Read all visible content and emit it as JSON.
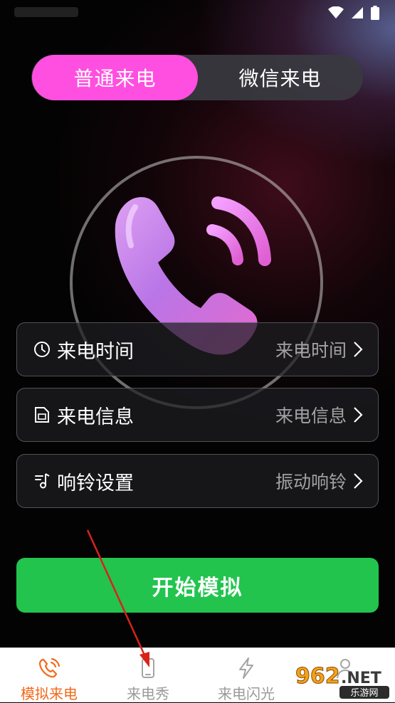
{
  "tabs": {
    "normal_call": "普通来电",
    "wechat_call": "微信来电"
  },
  "settings": [
    {
      "label": "来电时间",
      "value": "来电时间",
      "icon": "clock-icon"
    },
    {
      "label": "来电信息",
      "value": "来电信息",
      "icon": "sim-card-icon"
    },
    {
      "label": "响铃设置",
      "value": "振动响铃",
      "icon": "music-note-icon"
    }
  ],
  "start_button": "开始模拟",
  "bottom_nav": [
    {
      "label": "模拟来电",
      "icon": "phone-ringing-icon",
      "active": true
    },
    {
      "label": "来电秀",
      "icon": "smartphone-icon",
      "active": false
    },
    {
      "label": "来电闪光",
      "icon": "lightning-icon",
      "active": false
    },
    {
      "label": "",
      "icon": "person-icon",
      "active": false
    }
  ],
  "watermark": {
    "text": "962.NET",
    "subtext": "乐游网"
  },
  "colors": {
    "accent_pink": "#ff4fe0",
    "start_green": "#22c44e",
    "nav_active": "#f26a1b",
    "annotation_red": "#d9221a"
  }
}
